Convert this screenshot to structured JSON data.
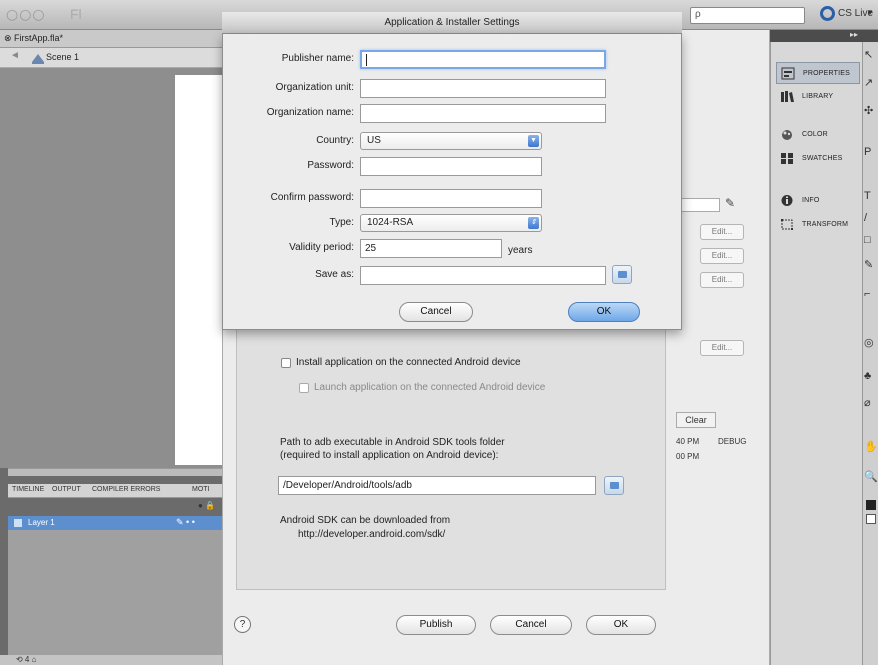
{
  "app": {
    "window_traffic": "○○○",
    "app_name": "Fl",
    "search_glyph": "ρ",
    "cs_live": "CS Live",
    "cs_live_arrow": "▼",
    "doc_tab": "FirstApp.fla*",
    "scene_back": "◄",
    "scene": "Scene 1"
  },
  "timeline": {
    "tabs": [
      "TIMELINE",
      "OUTPUT",
      "COMPILER ERRORS",
      "MOTI"
    ],
    "icons": "● 🔒",
    "layer_name": "Layer 1",
    "layer_pen": "✎ • •",
    "bottom_label": "⟲ 4 ⌂"
  },
  "panels": {
    "header_arrows": "▸▸",
    "items": [
      {
        "label": "PROPERTIES",
        "icon": "properties-icon",
        "selected": true
      },
      {
        "label": "LIBRARY",
        "icon": "library-icon",
        "selected": false
      },
      {
        "label": "COLOR",
        "icon": "color-icon",
        "selected": false
      },
      {
        "label": "SWATCHES",
        "icon": "swatches-icon",
        "selected": false
      },
      {
        "label": "INFO",
        "icon": "info-icon",
        "selected": false
      },
      {
        "label": "TRANSFORM",
        "icon": "transform-icon",
        "selected": false
      }
    ]
  },
  "tools_glyphs": [
    "↖",
    "↗",
    "✣",
    "P",
    "T",
    "/",
    "□",
    "✎",
    "⌐",
    "◎",
    "♣",
    "⌀",
    "✋",
    "🔍"
  ],
  "sheet": {
    "title": "Application & Installer Settings",
    "publisher_name": {
      "label": "Publisher name:",
      "value": ""
    },
    "organization_unit": {
      "label": "Organization unit:",
      "value": ""
    },
    "organization_name": {
      "label": "Organization name:",
      "value": ""
    },
    "country": {
      "label": "Country:",
      "value": "US"
    },
    "password": {
      "label": "Password:",
      "value": ""
    },
    "confirm_password": {
      "label": "Confirm password:",
      "value": ""
    },
    "type": {
      "label": "Type:",
      "value": "1024-RSA"
    },
    "validity_period": {
      "label": "Validity period:",
      "value": "25",
      "unit": "years"
    },
    "save_as": {
      "label": "Save as:",
      "value": ""
    },
    "cancel_label": "Cancel",
    "ok_label": "OK"
  },
  "publish_dialog": {
    "edit_label": "Edit...",
    "clear_label": "Clear",
    "times": [
      "40 PM",
      "00 PM"
    ],
    "debug_label": "DEBUG",
    "install_label": "Install application on the connected Android device",
    "launch_label": "Launch application on the connected Android device",
    "adb_label_1": "Path to adb executable in Android SDK tools folder",
    "adb_label_2": "(required to install application on Android device):",
    "adb_path": "/Developer/Android/tools/adb",
    "sdk_note_1": "Android SDK can be downloaded from",
    "sdk_note_2": "http://developer.android.com/sdk/",
    "help_label": "?",
    "publish_label": "Publish",
    "cancel_label": "Cancel",
    "ok_label": "OK"
  },
  "colors": {
    "accent": "#5b8fcf",
    "focus_ring": "#7aa7e8"
  }
}
